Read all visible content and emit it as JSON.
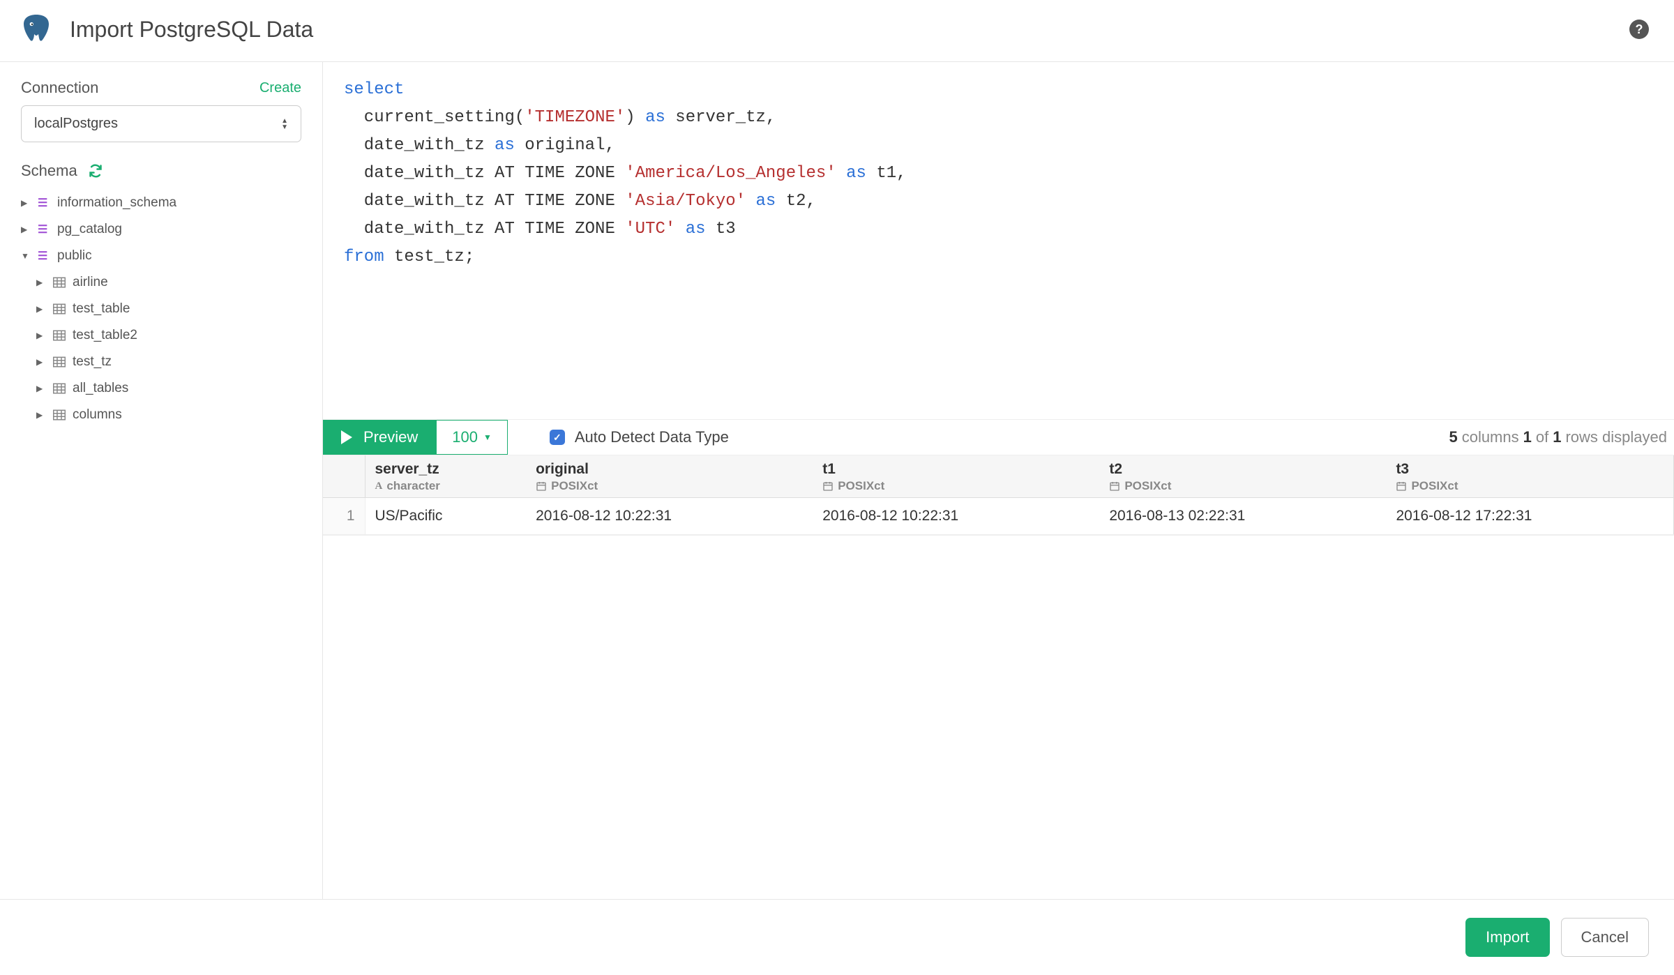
{
  "header": {
    "title": "Import PostgreSQL Data"
  },
  "sidebar": {
    "connection_label": "Connection",
    "create_label": "Create",
    "connection_value": "localPostgres",
    "schema_label": "Schema",
    "tree": [
      {
        "name": "information_schema",
        "kind": "schema",
        "expanded": false
      },
      {
        "name": "pg_catalog",
        "kind": "schema",
        "expanded": false
      },
      {
        "name": "public",
        "kind": "schema",
        "expanded": true,
        "children": [
          {
            "name": "airline",
            "kind": "table"
          },
          {
            "name": "test_table",
            "kind": "table"
          },
          {
            "name": "test_table2",
            "kind": "table"
          },
          {
            "name": "test_tz",
            "kind": "table"
          },
          {
            "name": "all_tables",
            "kind": "table"
          },
          {
            "name": "columns",
            "kind": "table"
          }
        ]
      }
    ]
  },
  "sql": {
    "tokens": [
      {
        "t": "select",
        "c": "kw"
      },
      {
        "t": "\n  current_setting("
      },
      {
        "t": "'TIMEZONE'",
        "c": "str"
      },
      {
        "t": ") "
      },
      {
        "t": "as",
        "c": "kw"
      },
      {
        "t": " server_tz,\n  date_with_tz "
      },
      {
        "t": "as",
        "c": "kw"
      },
      {
        "t": " original,\n  date_with_tz AT TIME ZONE "
      },
      {
        "t": "'America/Los_Angeles'",
        "c": "str"
      },
      {
        "t": " "
      },
      {
        "t": "as",
        "c": "kw"
      },
      {
        "t": " t1,\n  date_with_tz AT TIME ZONE "
      },
      {
        "t": "'Asia/Tokyo'",
        "c": "str"
      },
      {
        "t": " "
      },
      {
        "t": "as",
        "c": "kw"
      },
      {
        "t": " t2,\n  date_with_tz AT TIME ZONE "
      },
      {
        "t": "'UTC'",
        "c": "str"
      },
      {
        "t": " "
      },
      {
        "t": "as",
        "c": "kw"
      },
      {
        "t": " t3\n"
      },
      {
        "t": "from",
        "c": "kw"
      },
      {
        "t": " test_tz;"
      }
    ]
  },
  "preview": {
    "button_label": "Preview",
    "limit_label": "100",
    "auto_detect_label": "Auto Detect Data Type",
    "auto_detect_checked": true,
    "stats": {
      "col_count": "5",
      "rows_shown": "1",
      "rows_total": "1",
      "columns_word": " columns  ",
      "of_word": " of ",
      "rows_word": " rows displayed"
    }
  },
  "results": {
    "columns": [
      {
        "name": "server_tz",
        "type": "character",
        "type_icon": "char"
      },
      {
        "name": "original",
        "type": "POSIXct",
        "type_icon": "cal"
      },
      {
        "name": "t1",
        "type": "POSIXct",
        "type_icon": "cal"
      },
      {
        "name": "t2",
        "type": "POSIXct",
        "type_icon": "cal"
      },
      {
        "name": "t3",
        "type": "POSIXct",
        "type_icon": "cal"
      }
    ],
    "rows": [
      {
        "n": "1",
        "cells": [
          "US/Pacific",
          "2016-08-12 10:22:31",
          "2016-08-12 10:22:31",
          "2016-08-13 02:22:31",
          "2016-08-12 17:22:31"
        ]
      }
    ]
  },
  "footer": {
    "import_label": "Import",
    "cancel_label": "Cancel"
  }
}
